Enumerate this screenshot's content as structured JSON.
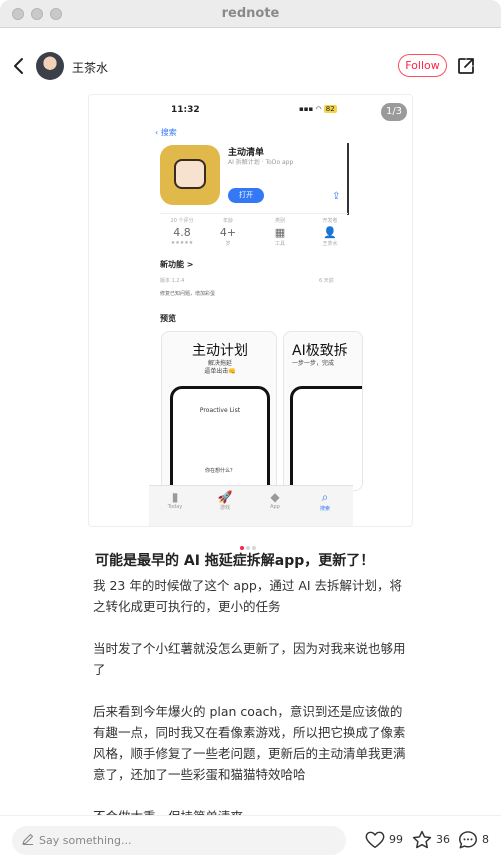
{
  "window": {
    "title": "rednote"
  },
  "header": {
    "username": "王茶水",
    "follow_label": "Follow"
  },
  "gallery": {
    "counter": "1/3",
    "screenshot": {
      "status_time": "11:32",
      "status_battery": "82",
      "back_label": "搜索",
      "app_name": "主动清单",
      "app_subtitle": "AI 拆解计划 · ToDo app",
      "open_label": "打开",
      "stats": [
        {
          "label": "20 个评分",
          "value": "4.8",
          "sub": "★★★★★"
        },
        {
          "label": "年龄",
          "value": "4+",
          "sub": "岁"
        },
        {
          "label": "类别",
          "value": "▦",
          "sub": "工具"
        },
        {
          "label": "开发者",
          "value": "👤",
          "sub": "王茶水"
        }
      ],
      "whats_new": "新功能 >",
      "version": "版本 1.2.4",
      "ago": "6 天前",
      "notes": "修复已知问题，增加彩蛋",
      "preview_label": "预览",
      "preview1_title": "主动计划",
      "preview1_sub": "解决拖延\n逼单出击👊",
      "preview1_phone_title": "Proactive List",
      "preview1_phone_q": "你在想什么？",
      "preview2_title": "AI极致拆",
      "preview2_sub": "一步一步，完成",
      "tabs": [
        {
          "icon": "▮",
          "label": "Today"
        },
        {
          "icon": "🚀",
          "label": "游戏"
        },
        {
          "icon": "◆",
          "label": "App"
        },
        {
          "icon": "⌕",
          "label": "搜索"
        }
      ]
    }
  },
  "post": {
    "title": "可能是最早的 AI 拖延症拆解app，更新了！",
    "paragraphs": [
      "我 23 年的时候做了这个 app，通过 AI 去拆解计划，将之转化成更可执行的，更小的任务",
      "当时发了个小红薯就没怎么更新了，因为对我来说也够用了",
      "后来看到今年爆火的 plan coach，意识到还是应该做的有趣一点，同时我又在看像素游戏，所以把它换成了像素风格，顺手修复了一些老问题，更新后的主动清单我更满意了，还加了一些彩蛋和猫猫特效哈哈",
      "不会做太重，保持简单清爽"
    ]
  },
  "footer": {
    "placeholder": "Say something...",
    "likes": "99",
    "collects": "36",
    "comments": "8"
  },
  "colors": {
    "accent": "#ff2442",
    "ios_blue": "#3478f6",
    "app_icon": "#e1b94a"
  }
}
